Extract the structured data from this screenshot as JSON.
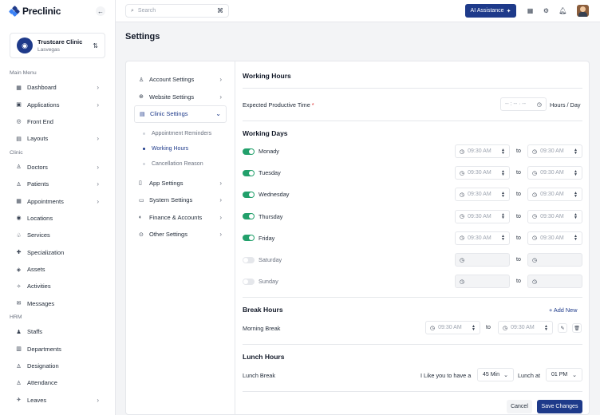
{
  "brand": {
    "name": "Preclinic"
  },
  "clinic": {
    "name": "Trustcare Clinic",
    "location": "Lasvegas"
  },
  "sidebar": {
    "sections": [
      {
        "title": "Main Menu",
        "items": [
          {
            "label": "Dashboard",
            "icon": "grid-icon",
            "chevron": true
          },
          {
            "label": "Applications",
            "icon": "apps-icon",
            "chevron": true
          },
          {
            "label": "Front End",
            "icon": "globe-icon",
            "chevron": false
          },
          {
            "label": "Layouts",
            "icon": "layout-icon",
            "chevron": true
          }
        ]
      },
      {
        "title": "Clinic",
        "items": [
          {
            "label": "Doctors",
            "icon": "doctor-icon",
            "chevron": true
          },
          {
            "label": "Patients",
            "icon": "patients-icon",
            "chevron": true
          },
          {
            "label": "Appointments",
            "icon": "calendar-icon",
            "chevron": true
          },
          {
            "label": "Locations",
            "icon": "location-icon",
            "chevron": false
          },
          {
            "label": "Services",
            "icon": "services-icon",
            "chevron": false
          },
          {
            "label": "Specialization",
            "icon": "specialization-icon",
            "chevron": false
          },
          {
            "label": "Assets",
            "icon": "assets-icon",
            "chevron": false
          },
          {
            "label": "Activities",
            "icon": "activities-icon",
            "chevron": false
          },
          {
            "label": "Messages",
            "icon": "messages-icon",
            "chevron": false
          }
        ]
      },
      {
        "title": "HRM",
        "items": [
          {
            "label": "Staffs",
            "icon": "staffs-icon",
            "chevron": false
          },
          {
            "label": "Departments",
            "icon": "departments-icon",
            "chevron": false
          },
          {
            "label": "Designation",
            "icon": "designation-icon",
            "chevron": false
          },
          {
            "label": "Attendance",
            "icon": "attendance-icon",
            "chevron": false
          },
          {
            "label": "Leaves",
            "icon": "leaves-icon",
            "chevron": true
          }
        ]
      }
    ]
  },
  "topbar": {
    "search_placeholder": "Search",
    "ai_label": "AI Assistance"
  },
  "page": {
    "title": "Settings"
  },
  "settings_nav": {
    "items": [
      {
        "label": "Account Settings",
        "icon": "account-icon"
      },
      {
        "label": "Website Settings",
        "icon": "website-icon"
      },
      {
        "label": "Clinic Settings",
        "icon": "clinic-icon",
        "active": true
      },
      {
        "label": "App Settings",
        "icon": "app-icon"
      },
      {
        "label": "System Settings",
        "icon": "system-icon"
      },
      {
        "label": "Finance & Accounts",
        "icon": "finance-icon"
      },
      {
        "label": "Other Settings",
        "icon": "other-icon"
      }
    ],
    "subitems": [
      {
        "label": "Appointment Reminders",
        "active": false
      },
      {
        "label": "Working Hours",
        "active": true
      },
      {
        "label": "Cancellation Reason",
        "active": false
      }
    ]
  },
  "working_hours": {
    "title": "Working Hours",
    "productive_label": "Expected Productive Time",
    "productive_required": "*",
    "productive_placeholder": "-- : -- · --",
    "productive_unit": "Hours / Day",
    "days_title": "Working Days",
    "to_label": "to",
    "days": [
      {
        "name": "Monady",
        "enabled": true,
        "from": "09:30 AM",
        "to": "09:30 AM"
      },
      {
        "name": "Tuesday",
        "enabled": true,
        "from": "09:30 AM",
        "to": "09:30 AM"
      },
      {
        "name": "Wednesday",
        "enabled": true,
        "from": "09:30 AM",
        "to": "09:30 AM"
      },
      {
        "name": "Thursday",
        "enabled": true,
        "from": "09:30 AM",
        "to": "09:30 AM"
      },
      {
        "name": "Friday",
        "enabled": true,
        "from": "09:30 AM",
        "to": "09:30 AM"
      },
      {
        "name": "Saturday",
        "enabled": false,
        "from": "",
        "to": ""
      },
      {
        "name": "Sunday",
        "enabled": false,
        "from": "",
        "to": ""
      }
    ]
  },
  "break_hours": {
    "title": "Break Hours",
    "add_label": "+ Add New",
    "row_label": "Morning Break",
    "from": "09:30 AM",
    "to": "09:30 AM"
  },
  "lunch_hours": {
    "title": "Lunch Hours",
    "row_label": "Lunch Break",
    "prefix": "I Like you to have a",
    "duration": "45 Min",
    "at_label": "Lunch at",
    "time": "01 PM"
  },
  "actions": {
    "cancel": "Cancel",
    "save": "Save Changes"
  },
  "colors": {
    "primary": "#1e3a8a",
    "toggle_on": "#22a06b"
  }
}
